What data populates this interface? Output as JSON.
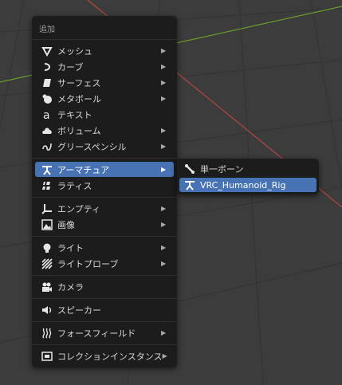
{
  "menu": {
    "title": "追加",
    "items": [
      {
        "label": "メッシュ",
        "icon": "mesh-icon",
        "submenu": true
      },
      {
        "label": "カーブ",
        "icon": "curve-icon",
        "submenu": true
      },
      {
        "label": "サーフェス",
        "icon": "surface-icon",
        "submenu": true
      },
      {
        "label": "メタボール",
        "icon": "metaball-icon",
        "submenu": true
      },
      {
        "label": "テキスト",
        "icon": "text-icon",
        "submenu": false
      },
      {
        "label": "ボリューム",
        "icon": "volume-icon",
        "submenu": true
      },
      {
        "label": "グリースペンシル",
        "icon": "grease-pencil-icon",
        "submenu": true
      },
      {
        "label": "アーマチュア",
        "icon": "armature-icon",
        "submenu": true,
        "active": true
      },
      {
        "label": "ラティス",
        "icon": "lattice-icon",
        "submenu": false
      },
      {
        "label": "エンプティ",
        "icon": "empty-icon",
        "submenu": true
      },
      {
        "label": "画像",
        "icon": "image-icon",
        "submenu": true
      },
      {
        "label": "ライト",
        "icon": "light-icon",
        "submenu": true
      },
      {
        "label": "ライトプローブ",
        "icon": "light-probe-icon",
        "submenu": true
      },
      {
        "label": "カメラ",
        "icon": "camera-icon",
        "submenu": false
      },
      {
        "label": "スピーカー",
        "icon": "speaker-icon",
        "submenu": false
      },
      {
        "label": "フォースフィールド",
        "icon": "force-field-icon",
        "submenu": true
      },
      {
        "label": "コレクションインスタンス",
        "icon": "collection-instance-icon",
        "submenu": true
      }
    ]
  },
  "armature_submenu": {
    "items": [
      {
        "label": "単一ボーン",
        "icon": "bone-icon"
      },
      {
        "label": "VRC_Humanoid_Rig",
        "icon": "armature-icon",
        "active": true
      }
    ]
  },
  "colors": {
    "viewport_bg": "#3c3c3c",
    "menu_bg": "#1c1c1c",
    "highlight": "#4772b3",
    "grid_x_axis": "#b5463f",
    "grid_y_axis": "#6d9a2c"
  }
}
